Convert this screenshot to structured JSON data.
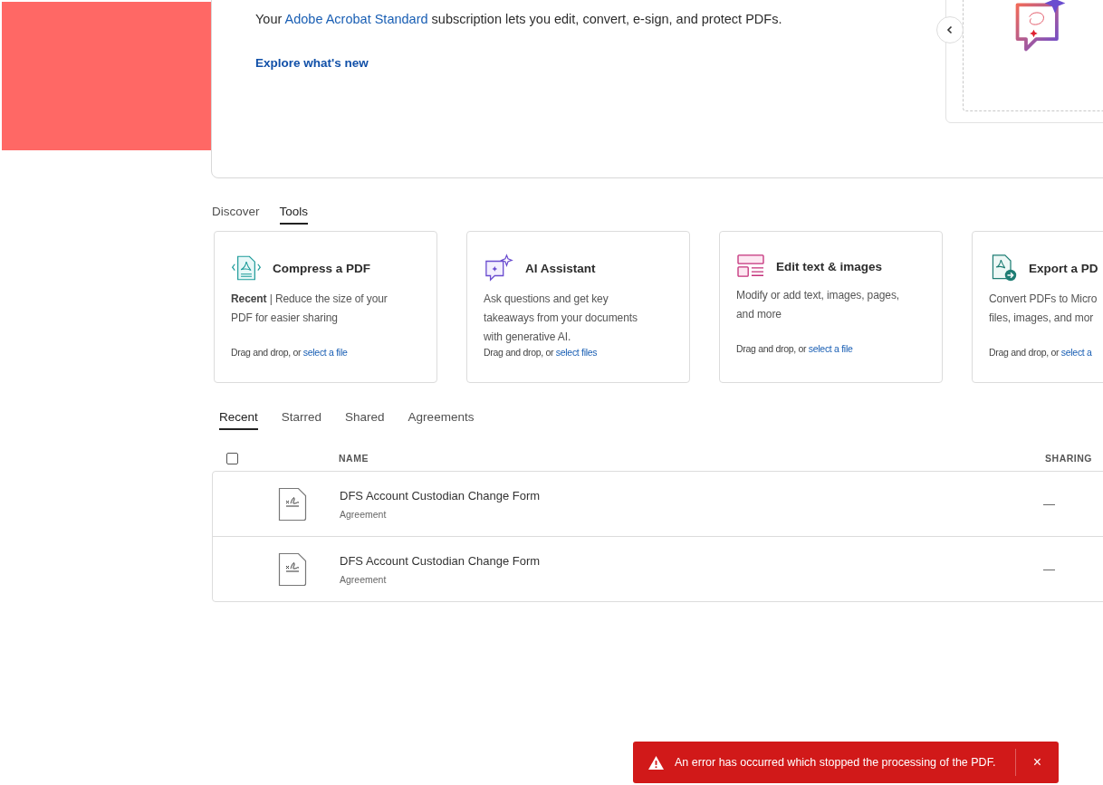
{
  "banner": {
    "message": [
      {
        "kind": "text",
        "text": "Your "
      },
      {
        "kind": "link",
        "text": "Adobe Acrobat Standard"
      },
      {
        "kind": "text",
        "text": " subscription lets you edit, convert, e-sign, and protect PDFs."
      }
    ],
    "link": "Explore what's new"
  },
  "section_tabs": [
    {
      "label": "Discover",
      "selected": false
    },
    {
      "label": "Tools",
      "selected": true
    }
  ],
  "tools": [
    {
      "kind": "compress",
      "title": "Compress a PDF",
      "description": [
        "**Recent** | Reduce the size of your",
        "PDF for easier sharing"
      ],
      "drop_text": "Drag and drop, or",
      "drop_link": "select a file"
    },
    {
      "kind": "ai",
      "title": "AI Assistant",
      "description": [
        "Ask questions and get key",
        "takeaways from your documents",
        "with generative AI."
      ],
      "drop_text": "Drag and drop, or",
      "drop_link": "select files"
    },
    {
      "kind": "edit",
      "title": "Edit text & images",
      "description": [
        "Modify or add text, images, pages,",
        "and more"
      ],
      "drop_text": "Drag and drop, or",
      "drop_link": "select a file"
    },
    {
      "kind": "export",
      "title": "Export a PD",
      "description": [
        "Convert PDFs to Micro",
        "files, images, and mor"
      ],
      "drop_text": "Drag and drop, or",
      "drop_link": "select a"
    }
  ],
  "file_tabs": [
    {
      "label": "Recent",
      "selected": true
    },
    {
      "label": "Starred",
      "selected": false
    },
    {
      "label": "Shared",
      "selected": false
    },
    {
      "label": "Agreements",
      "selected": false
    }
  ],
  "table": {
    "select_all": {
      "checked": false
    },
    "columns": [
      "NAME",
      "SHARING"
    ],
    "rows": [
      {
        "name": "DFS Account Custodian Change Form",
        "type": "Agreement",
        "sharing": "—"
      },
      {
        "name": "DFS Account Custodian Change Form",
        "type": "Agreement",
        "sharing": "—"
      }
    ]
  },
  "toast": {
    "kind": "error",
    "message": "An error has occurred which stopped the processing of the PDF.",
    "close": "×"
  }
}
